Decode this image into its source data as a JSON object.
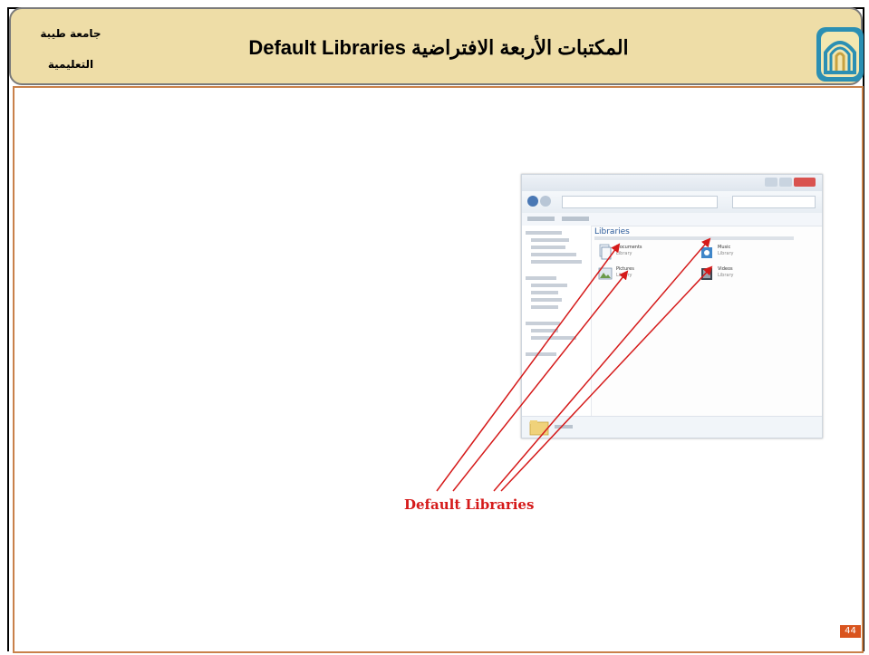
{
  "header": {
    "university_line1": "جامعة طيبة",
    "university_line2": "التعليمية",
    "title": "المكتبات الأربعة الافتراضية Default  Libraries",
    "logo_icon": "taibah-university-logo-icon"
  },
  "screenshot": {
    "heading": "Libraries",
    "libraries": [
      {
        "name": "Documents",
        "kind": "Library",
        "icon": "documents-library-icon"
      },
      {
        "name": "Music",
        "kind": "Library",
        "icon": "music-library-icon"
      },
      {
        "name": "Pictures",
        "kind": "Library",
        "icon": "pictures-library-icon"
      },
      {
        "name": "Videos",
        "kind": "Library",
        "icon": "videos-library-icon"
      }
    ]
  },
  "callout": {
    "label": "Default Libraries",
    "color": "#d51a1a"
  },
  "footer": {
    "page_number": "44",
    "badge_color": "#d9541e"
  },
  "colors": {
    "header_fill": "#eedda7",
    "frame_accent": "#c9814a"
  }
}
